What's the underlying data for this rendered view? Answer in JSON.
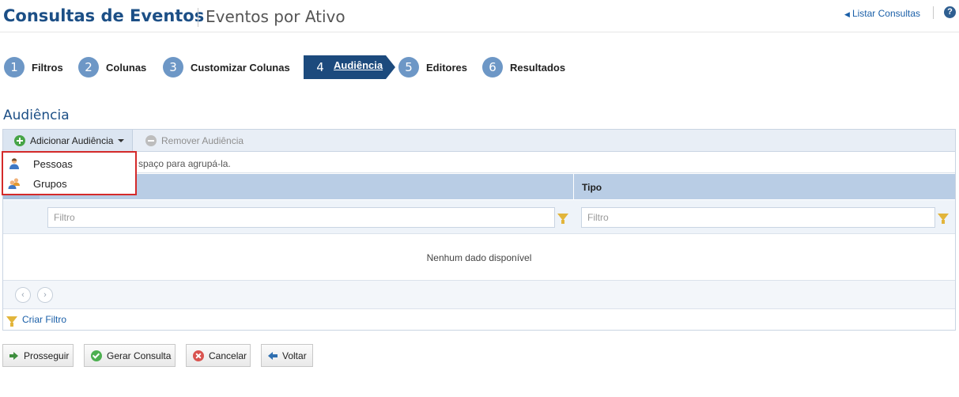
{
  "header": {
    "title": "Consultas de Eventos",
    "subtitle": "Eventos por Ativo",
    "list_link": "Listar Consultas",
    "help_label": "?"
  },
  "steps": [
    {
      "number": "1",
      "label": "Filtros"
    },
    {
      "number": "2",
      "label": "Colunas"
    },
    {
      "number": "3",
      "label": "Customizar Colunas"
    },
    {
      "number": "4",
      "label": "Audiência",
      "active": true
    },
    {
      "number": "5",
      "label": "Editores"
    },
    {
      "number": "6",
      "label": "Resultados"
    }
  ],
  "section_title": "Audiência",
  "toolbar": {
    "add_label": "Adicionar Audiência",
    "remove_label": "Remover Audiência"
  },
  "group_hint": "spaço para agrupá-la.",
  "columns": {
    "tipo": "Tipo"
  },
  "filters": {
    "placeholder_1": "Filtro",
    "placeholder_2": "Filtro"
  },
  "empty_text": "Nenhum dado disponível",
  "pager": {
    "prev": "‹",
    "next": "›"
  },
  "create_filter_label": "Criar Filtro",
  "dropdown": {
    "items": [
      {
        "label": "Pessoas",
        "icon": "person-icon"
      },
      {
        "label": "Grupos",
        "icon": "group-icon"
      }
    ]
  },
  "buttons": {
    "proceed": "Prosseguir",
    "generate": "Gerar Consulta",
    "cancel": "Cancelar",
    "back": "Voltar"
  },
  "colors": {
    "brand": "#1c4f86",
    "active_step": "#1c4a7d",
    "step_circle": "#6d97c6",
    "menu_border": "#d42a2a"
  }
}
